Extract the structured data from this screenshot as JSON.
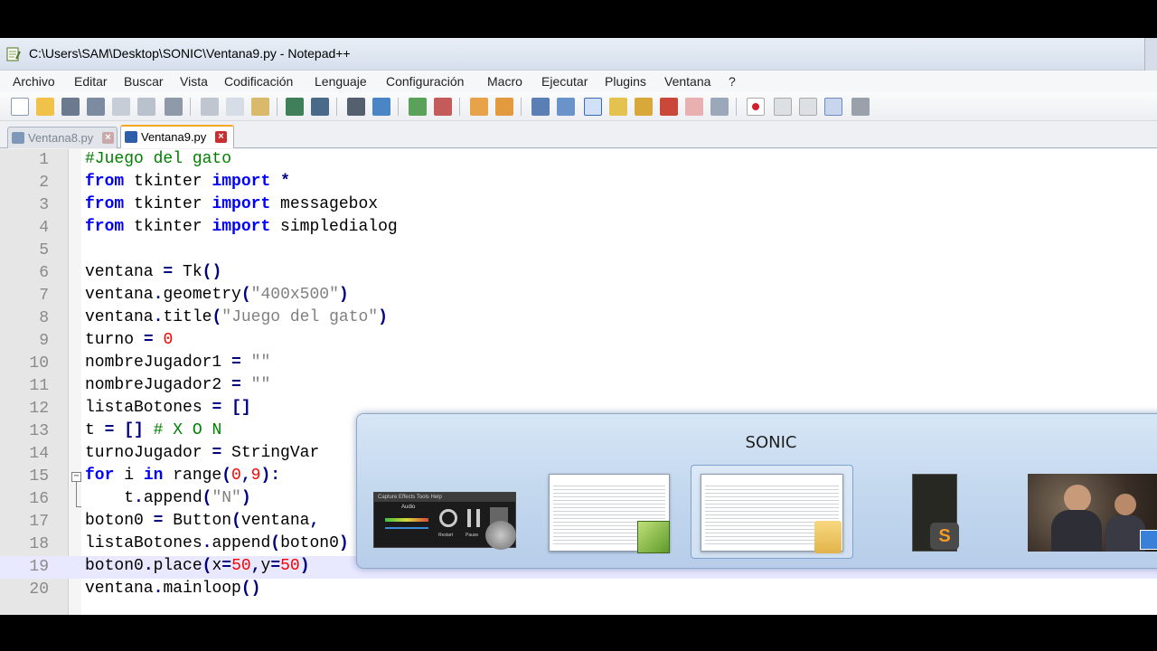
{
  "window": {
    "title": "C:\\Users\\SAM\\Desktop\\SONIC\\Ventana9.py - Notepad++"
  },
  "menu": [
    "Archivo",
    "Editar",
    "Buscar",
    "Vista",
    "Codificación",
    "Lenguaje",
    "Configuración",
    "Macro",
    "Ejecutar",
    "Plugins",
    "Ventana",
    "?"
  ],
  "toolbar": {
    "icons": [
      "new-file-icon",
      "open-file-icon",
      "save-icon",
      "save-all-icon",
      "close-icon",
      "close-all-icon",
      "print-icon",
      "cut-icon",
      "copy-icon",
      "paste-icon",
      "undo-icon",
      "redo-icon",
      "find-icon",
      "replace-icon",
      "zoom-in-icon",
      "zoom-out-icon",
      "sync-vertical-icon",
      "sync-horizontal-icon",
      "word-wrap-icon",
      "show-all-chars-icon",
      "indent-guide-icon",
      "user-language-icon",
      "document-map-icon",
      "function-list-icon",
      "folder-workspace-icon",
      "monitor-icon",
      "record-macro-icon",
      "stop-macro-icon",
      "play-macro-icon",
      "run-macro-multiple-icon",
      "save-macro-icon"
    ]
  },
  "tabs": [
    {
      "label": "Ventana8.py",
      "active": false
    },
    {
      "label": "Ventana9.py",
      "active": true
    }
  ],
  "editor": {
    "current_line": 19,
    "lines": [
      {
        "n": "1",
        "tokens": [
          {
            "t": "#Juego del gato",
            "c": "comment"
          }
        ]
      },
      {
        "n": "2",
        "tokens": [
          {
            "t": "from",
            "c": "kw"
          },
          {
            "t": " tkinter "
          },
          {
            "t": "import",
            "c": "kw"
          },
          {
            "t": " "
          },
          {
            "t": "*",
            "c": "op"
          }
        ]
      },
      {
        "n": "3",
        "tokens": [
          {
            "t": "from",
            "c": "kw"
          },
          {
            "t": " tkinter "
          },
          {
            "t": "import",
            "c": "kw"
          },
          {
            "t": " messagebox"
          }
        ]
      },
      {
        "n": "4",
        "tokens": [
          {
            "t": "from",
            "c": "kw"
          },
          {
            "t": " tkinter "
          },
          {
            "t": "import",
            "c": "kw"
          },
          {
            "t": " simpledialog"
          }
        ]
      },
      {
        "n": "5",
        "tokens": []
      },
      {
        "n": "6",
        "tokens": [
          {
            "t": "ventana "
          },
          {
            "t": "=",
            "c": "op"
          },
          {
            "t": " Tk"
          },
          {
            "t": "()",
            "c": "op"
          }
        ]
      },
      {
        "n": "7",
        "tokens": [
          {
            "t": "ventana"
          },
          {
            "t": ".",
            "c": "op"
          },
          {
            "t": "geometry"
          },
          {
            "t": "(",
            "c": "op"
          },
          {
            "t": "\"400x500\"",
            "c": "str"
          },
          {
            "t": ")",
            "c": "op"
          }
        ]
      },
      {
        "n": "8",
        "tokens": [
          {
            "t": "ventana"
          },
          {
            "t": ".",
            "c": "op"
          },
          {
            "t": "title"
          },
          {
            "t": "(",
            "c": "op"
          },
          {
            "t": "\"Juego del gato\"",
            "c": "str"
          },
          {
            "t": ")",
            "c": "op"
          }
        ]
      },
      {
        "n": "9",
        "tokens": [
          {
            "t": "turno "
          },
          {
            "t": "=",
            "c": "op"
          },
          {
            "t": " "
          },
          {
            "t": "0",
            "c": "num"
          }
        ]
      },
      {
        "n": "10",
        "tokens": [
          {
            "t": "nombreJugador1 "
          },
          {
            "t": "=",
            "c": "op"
          },
          {
            "t": " "
          },
          {
            "t": "\"\"",
            "c": "str"
          }
        ]
      },
      {
        "n": "11",
        "tokens": [
          {
            "t": "nombreJugador2 "
          },
          {
            "t": "=",
            "c": "op"
          },
          {
            "t": " "
          },
          {
            "t": "\"\"",
            "c": "str"
          }
        ]
      },
      {
        "n": "12",
        "tokens": [
          {
            "t": "listaBotones "
          },
          {
            "t": "=",
            "c": "op"
          },
          {
            "t": " "
          },
          {
            "t": "[]",
            "c": "op"
          }
        ]
      },
      {
        "n": "13",
        "tokens": [
          {
            "t": "t "
          },
          {
            "t": "=",
            "c": "op"
          },
          {
            "t": " "
          },
          {
            "t": "[]",
            "c": "op"
          },
          {
            "t": " "
          },
          {
            "t": "# X O N",
            "c": "comment"
          }
        ]
      },
      {
        "n": "14",
        "tokens": [
          {
            "t": "turnoJugador "
          },
          {
            "t": "=",
            "c": "op"
          },
          {
            "t": " StringVar"
          }
        ]
      },
      {
        "n": "15",
        "tokens": [
          {
            "t": "for",
            "c": "kw"
          },
          {
            "t": " i "
          },
          {
            "t": "in",
            "c": "kw"
          },
          {
            "t": " range"
          },
          {
            "t": "(",
            "c": "op"
          },
          {
            "t": "0",
            "c": "num"
          },
          {
            "t": ",",
            "c": "op"
          },
          {
            "t": "9",
            "c": "num"
          },
          {
            "t": "):",
            "c": "op"
          }
        ]
      },
      {
        "n": "16",
        "tokens": [
          {
            "t": "    t"
          },
          {
            "t": ".",
            "c": "op"
          },
          {
            "t": "append"
          },
          {
            "t": "(",
            "c": "op"
          },
          {
            "t": "\"N\"",
            "c": "str"
          },
          {
            "t": ")",
            "c": "op"
          }
        ]
      },
      {
        "n": "17",
        "tokens": [
          {
            "t": "boton0 "
          },
          {
            "t": "=",
            "c": "op"
          },
          {
            "t": " Button"
          },
          {
            "t": "(",
            "c": "op"
          },
          {
            "t": "ventana"
          },
          {
            "t": ",",
            "c": "op"
          }
        ]
      },
      {
        "n": "18",
        "tokens": [
          {
            "t": "listaBotones"
          },
          {
            "t": ".",
            "c": "op"
          },
          {
            "t": "append"
          },
          {
            "t": "(",
            "c": "op"
          },
          {
            "t": "boton0"
          },
          {
            "t": ")",
            "c": "op"
          }
        ]
      },
      {
        "n": "19",
        "tokens": [
          {
            "t": "boton0"
          },
          {
            "t": ".",
            "c": "op"
          },
          {
            "t": "place"
          },
          {
            "t": "(",
            "c": "op"
          },
          {
            "t": "x"
          },
          {
            "t": "=",
            "c": "op"
          },
          {
            "t": "50",
            "c": "num"
          },
          {
            "t": ",",
            "c": "op"
          },
          {
            "t": "y"
          },
          {
            "t": "=",
            "c": "op"
          },
          {
            "t": "50",
            "c": "num"
          },
          {
            "t": ")",
            "c": "op"
          }
        ]
      },
      {
        "n": "20",
        "tokens": [
          {
            "t": "ventana"
          },
          {
            "t": ".",
            "c": "op"
          },
          {
            "t": "mainloop"
          },
          {
            "t": "()",
            "c": "op"
          }
        ]
      }
    ]
  },
  "task_switcher": {
    "title": "SONIC",
    "audio_menu": "Capture   Effects   Tools   Help",
    "audio_label": "Audio",
    "audio_restart": "Restart",
    "audio_pause": "Pause",
    "items": [
      {
        "name": "audio-recorder-thumbnail",
        "selected": false
      },
      {
        "name": "notepad-plus-plus-thumbnail",
        "selected": false
      },
      {
        "name": "sonic-folder-thumbnail",
        "selected": true
      },
      {
        "name": "sublime-text-thumbnail",
        "selected": false
      },
      {
        "name": "photo-viewer-thumbnail",
        "selected": false
      }
    ]
  }
}
